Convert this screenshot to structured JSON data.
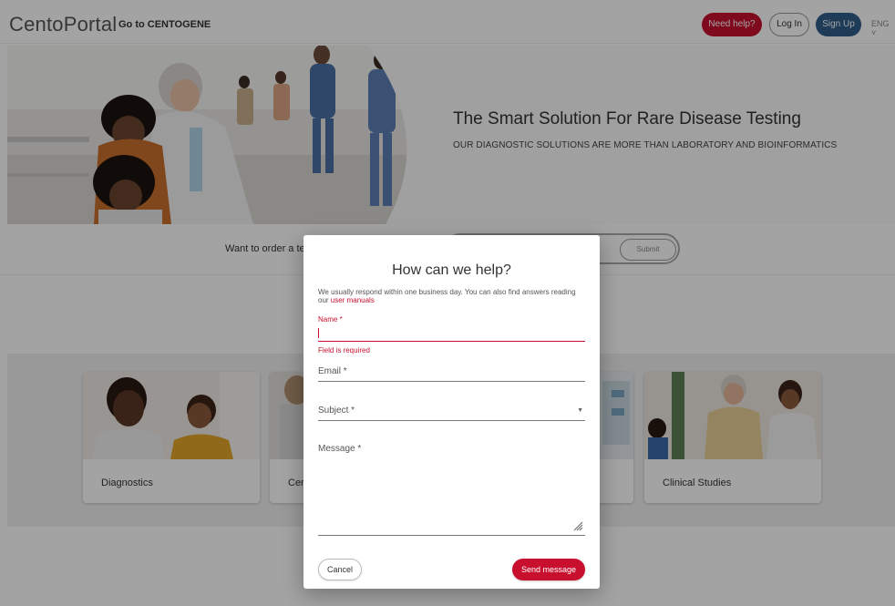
{
  "header": {
    "logo": "CentoPortal",
    "goto_link": "Go to CENTOGENE",
    "need_help": "Need help?",
    "login": "Log In",
    "signup": "Sign Up",
    "language": "ENG ˅"
  },
  "hero": {
    "title": "The Smart Solution For Rare Disease Testing",
    "subtitle": "OUR DIAGNOSTIC SOLUTIONS ARE MORE THAN LABORATORY AND BIOINFORMATICS"
  },
  "order": {
    "prompt": "Want to order a tes",
    "submit": "Submit"
  },
  "cards": [
    {
      "title": "Diagnostics"
    },
    {
      "title": "Cen"
    },
    {
      "title": ""
    },
    {
      "title": "Clinical Studies"
    }
  ],
  "modal": {
    "title": "How can we help?",
    "description": "We usually respond within one business day. You can also find answers reading our",
    "manuals_link": "user manuals",
    "name_label": "Name *",
    "name_error": "Field is required",
    "email_label": "Email *",
    "subject_label": "Subject *",
    "message_label": "Message *",
    "cancel": "Cancel",
    "send": "Send message"
  },
  "colors": {
    "accent_red": "#c8102e",
    "signup_blue": "#2f5d8a"
  },
  "icons": {
    "dropdown": "triangle-down-icon",
    "resize": "resize-handle-icon"
  }
}
